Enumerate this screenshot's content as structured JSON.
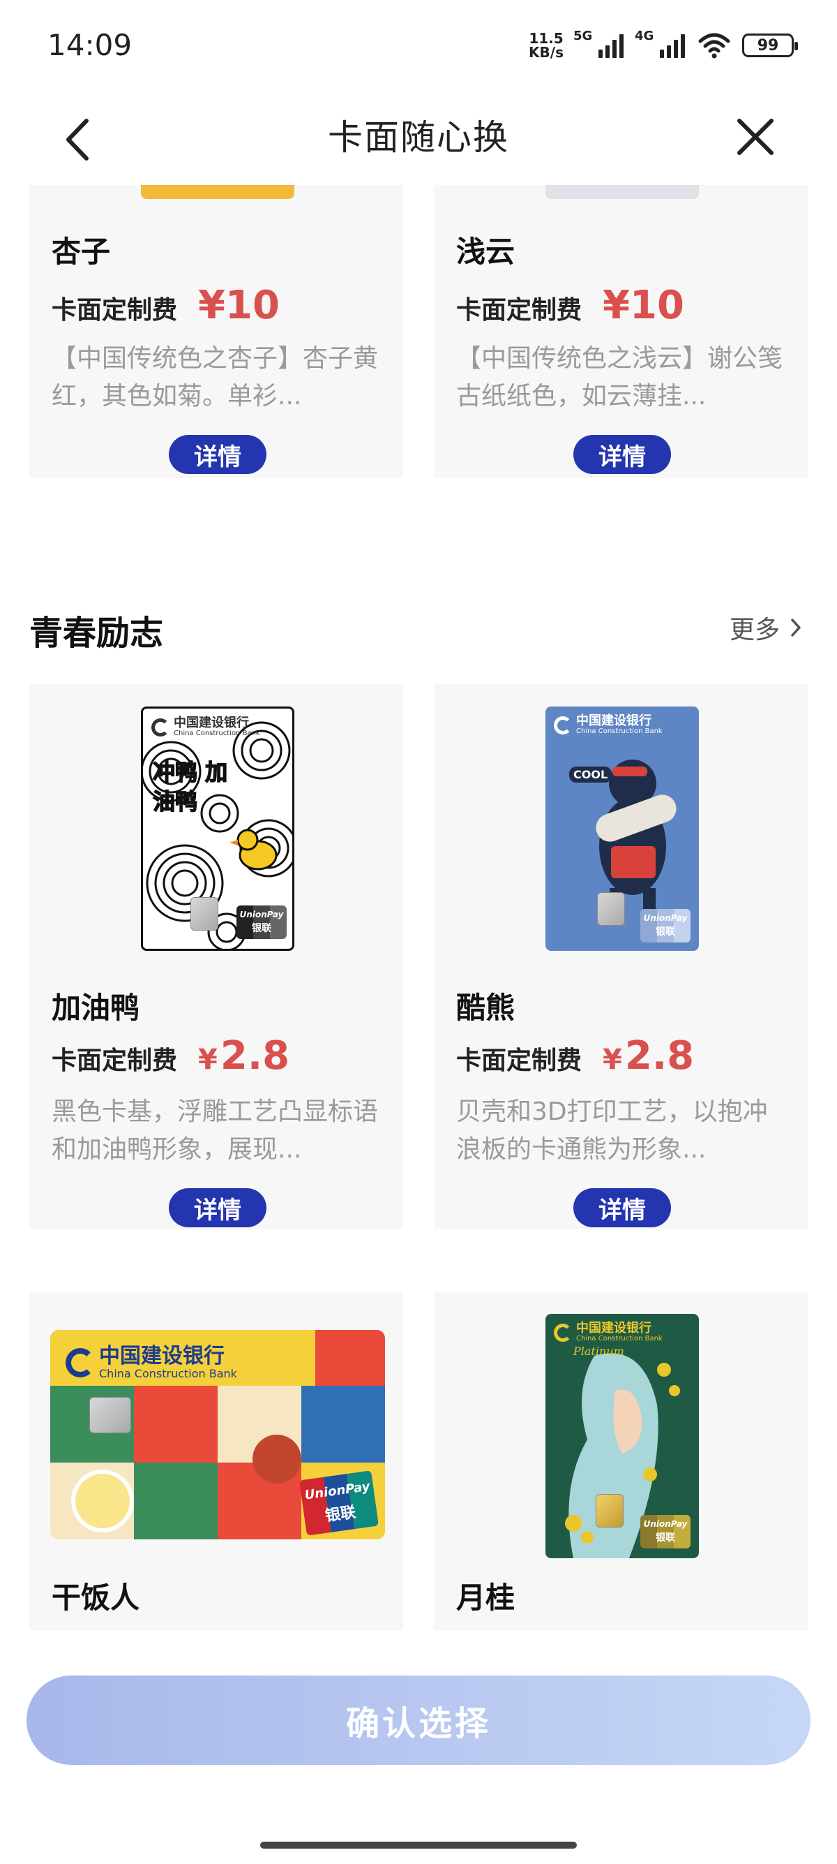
{
  "status_bar": {
    "time": "14:09",
    "net_speed_value": "11.5",
    "net_speed_unit": "KB/s",
    "sim1": "5G",
    "sim2": "4G",
    "battery": "99"
  },
  "nav": {
    "title": "卡面随心换",
    "back_icon": "chevron-left-icon",
    "close_icon": "close-icon"
  },
  "top_cards": [
    {
      "name": "杏子",
      "fee_label": "卡面定制费",
      "fee_price": "¥10",
      "desc": "【中国传统色之杏子】杏子黄红，其色如菊。单衫...",
      "detail_label": "详情"
    },
    {
      "name": "浅云",
      "fee_label": "卡面定制费",
      "fee_price": "¥10",
      "desc": "【中国传统色之浅云】谢公笺古纸纸色，如云薄挂...",
      "detail_label": "详情"
    }
  ],
  "section": {
    "title": "青春励志",
    "more_label": "更多"
  },
  "youth_cards": [
    {
      "name": "加油鸭",
      "fee_label": "卡面定制费",
      "fee_yen": "¥",
      "fee_amount": "2.8",
      "desc": "黑色卡基，浮雕工艺凸显标语和加油鸭形象，展现...",
      "detail_label": "详情",
      "art_text": "冲鸭 加油鸭"
    },
    {
      "name": "酷熊",
      "fee_label": "卡面定制费",
      "fee_yen": "¥",
      "fee_amount": "2.8",
      "desc": "贝壳和3D打印工艺，以抱冲浪板的卡通熊为形象...",
      "detail_label": "详情",
      "art_text": "COOL"
    },
    {
      "name": "干饭人"
    },
    {
      "name": "月桂"
    }
  ],
  "card_brand": {
    "bank_cn": "中国建设银行",
    "bank_en": "China Construction Bank",
    "tier": "Platinum",
    "network_en": "UnionPay",
    "network_cn": "银联"
  },
  "confirm": {
    "label": "确认选择"
  },
  "colors": {
    "accent_blue": "#2435b0",
    "price_red": "#d9514e",
    "confirm_gradient_start": "#a8b7ea",
    "confirm_gradient_end": "#c6d7f6"
  }
}
